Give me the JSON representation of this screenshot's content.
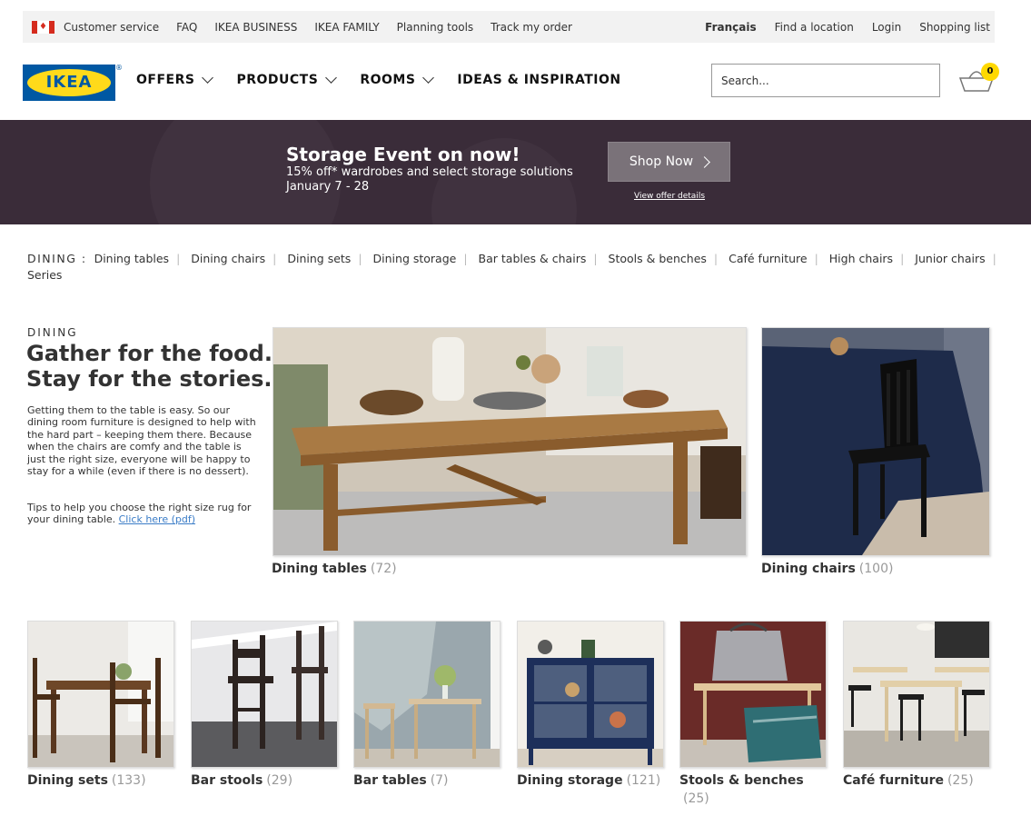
{
  "utility": {
    "left": [
      "Customer service",
      "FAQ",
      "IKEA BUSINESS",
      "IKEA FAMILY",
      "Planning tools",
      "Track my order"
    ],
    "right": [
      "Français",
      "Find a location",
      "Login",
      "Shopping list"
    ]
  },
  "logo": {
    "text": "IKEA",
    "reg": "®"
  },
  "nav": [
    "OFFERS",
    "PRODUCTS",
    "ROOMS",
    "IDEAS & INSPIRATION"
  ],
  "search": {
    "placeholder": "Search..."
  },
  "cart": {
    "count": "0"
  },
  "banner": {
    "title": "Storage Event on now!",
    "line1": "15% off* wardrobes and select storage solutions",
    "line2": "January 7 - 28",
    "button": "Shop Now",
    "link": "View offer details"
  },
  "catnav": {
    "label": "DINING :",
    "items": [
      "Dining tables",
      "Dining chairs",
      "Dining sets",
      "Dining storage",
      "Bar tables & chairs",
      "Stools & benches",
      "Café furniture",
      "High chairs",
      "Junior chairs",
      "Series"
    ]
  },
  "intro": {
    "eyebrow": "DINING",
    "headline1": "Gather for the food.",
    "headline2": "Stay for the stories.",
    "body": "Getting them to the table is easy. So our dining room furniture is designed to help with the hard part – keeping them there. Because when the chairs are comfy and the table is just the right size, everyone will be happy to stay for a while (even if there is no dessert).",
    "tip": "Tips to help you choose the right size rug for your dining table.",
    "tip_link": "Click here (pdf)"
  },
  "tiles": [
    {
      "label": "Dining tables",
      "count": "(72)"
    },
    {
      "label": "Dining chairs",
      "count": "(100)"
    },
    {
      "label": "Dining sets",
      "count": "(133)"
    },
    {
      "label": "Bar stools",
      "count": "(29)"
    },
    {
      "label": "Bar tables",
      "count": "(7)"
    },
    {
      "label": "Dining storage",
      "count": "(121)"
    },
    {
      "label": "Stools & benches",
      "count": "(25)"
    },
    {
      "label": "Café furniture",
      "count": "(25)"
    }
  ],
  "colors": {
    "brand_blue": "#0058a3",
    "brand_yellow": "#ffda1a",
    "banner_bg": "#3a2c39",
    "link": "#3a7cc7"
  }
}
